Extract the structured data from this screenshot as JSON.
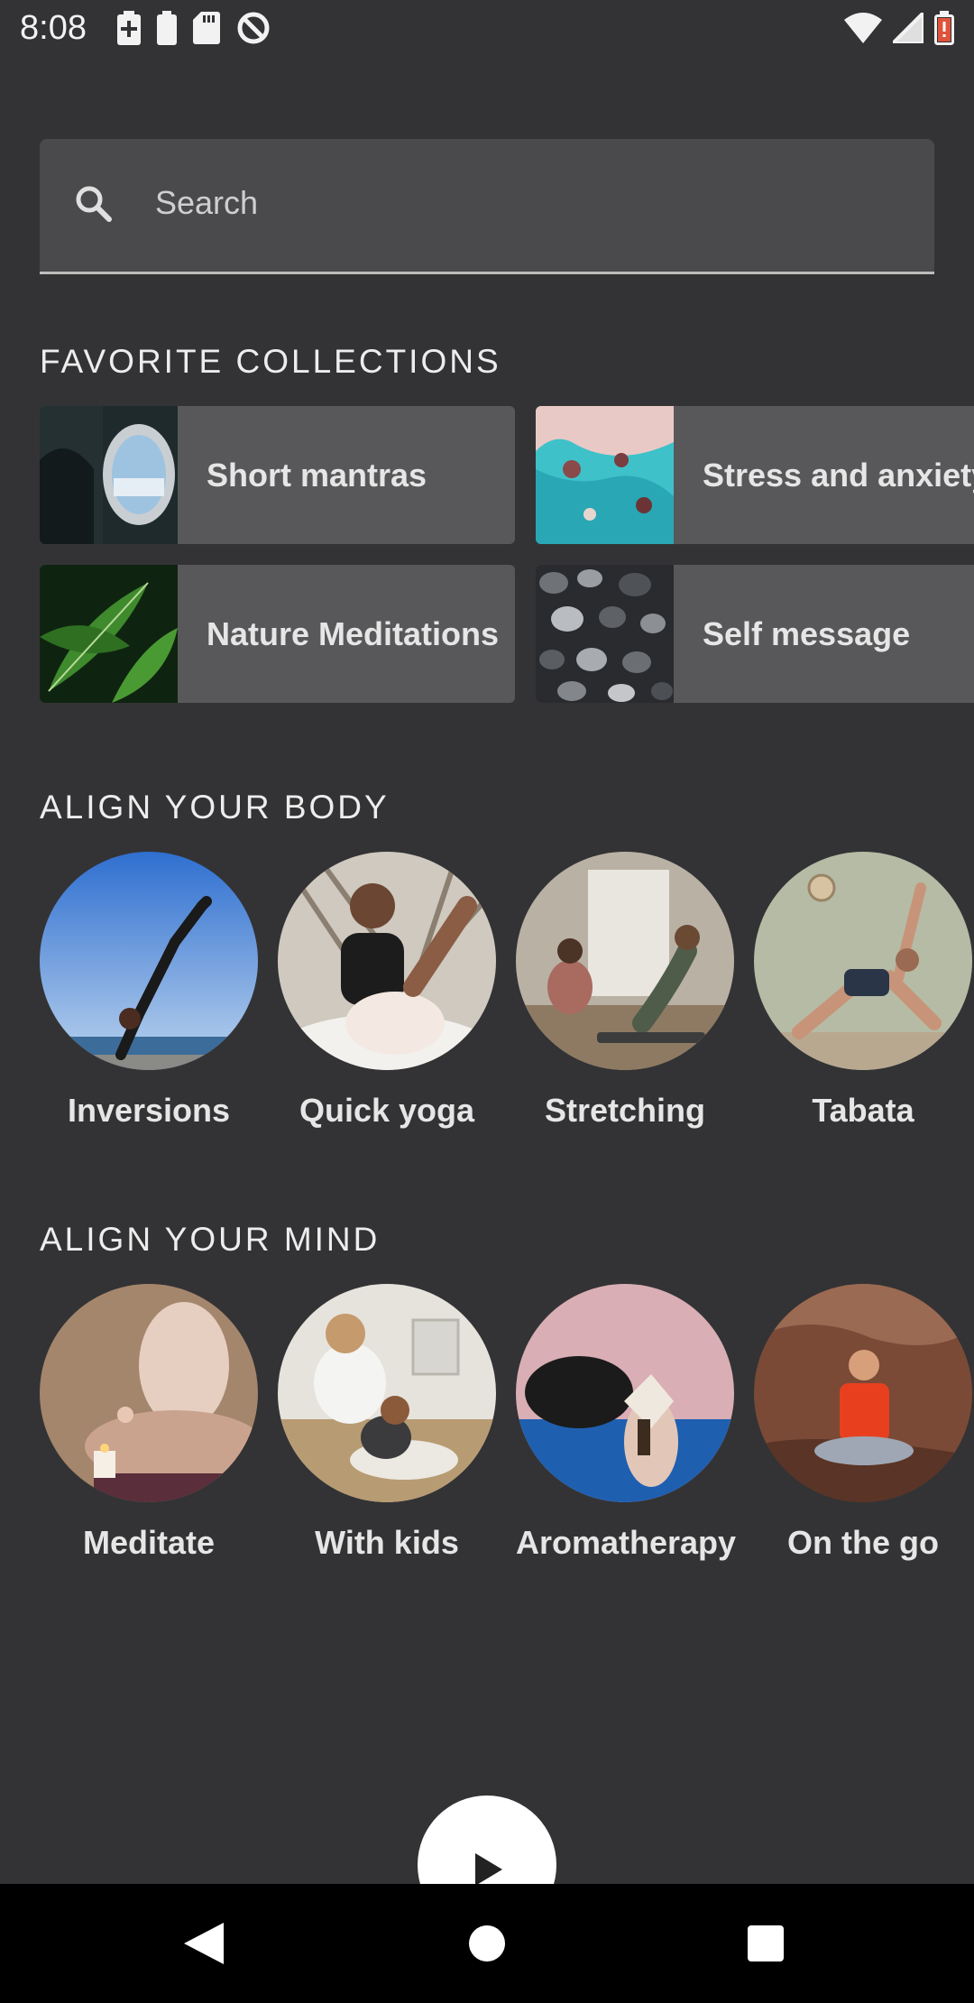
{
  "status": {
    "time": "8:08",
    "left_icons": [
      "battery-saver-icon",
      "battery-icon",
      "sd-card-icon",
      "data-saver-icon"
    ],
    "right_icons": [
      "wifi-icon",
      "cell-signal-icon",
      "battery-low-icon"
    ]
  },
  "search": {
    "placeholder": "Search"
  },
  "favorites": {
    "title": "FAVORITE COLLECTIONS",
    "items": [
      {
        "label": "Short mantras",
        "icon": "airplane-window-thumbnail"
      },
      {
        "label": "Stress and anxiety",
        "icon": "aerial-sea-thumbnail"
      },
      {
        "label": "Nature Meditations",
        "icon": "leaves-thumbnail"
      },
      {
        "label": "Self message",
        "icon": "pebbles-thumbnail"
      }
    ]
  },
  "body": {
    "title": "ALIGN YOUR BODY",
    "items": [
      {
        "label": "Inversions"
      },
      {
        "label": "Quick yoga"
      },
      {
        "label": "Stretching"
      },
      {
        "label": "Tabata"
      }
    ]
  },
  "mind": {
    "title": "ALIGN YOUR MIND",
    "items": [
      {
        "label": "Meditate"
      },
      {
        "label": "With kids"
      },
      {
        "label": "Aromatherapy"
      },
      {
        "label": "On the go"
      }
    ]
  },
  "colors": {
    "background": "#333335",
    "card": "#58585a",
    "search_bg": "#4a4a4c"
  }
}
